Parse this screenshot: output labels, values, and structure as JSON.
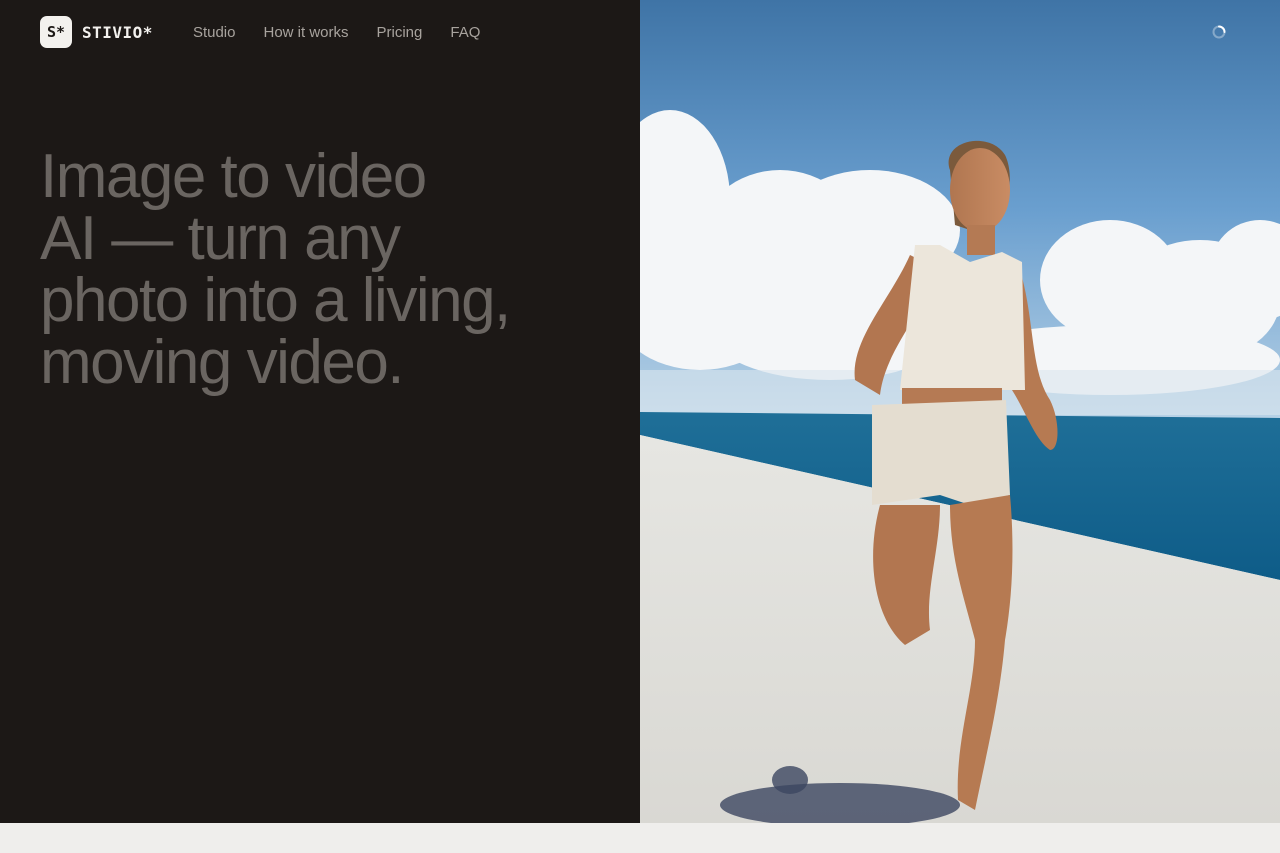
{
  "brand": {
    "logo_mark": "S*",
    "name": "STIVIO*"
  },
  "nav": {
    "items": [
      "Studio",
      "How it works",
      "Pricing",
      "FAQ"
    ]
  },
  "hero": {
    "headline": [
      "Image to video",
      "AI — turn any",
      "photo into a living,",
      "moving video."
    ]
  },
  "media": {
    "kind": "video-preview"
  },
  "icons": {
    "loading": "loading-spinner-icon"
  },
  "colors": {
    "panel_bg": "#1c1816",
    "headline": "#6a6561",
    "nav_link": "#a8a39e",
    "page_bg": "#efeeec"
  }
}
